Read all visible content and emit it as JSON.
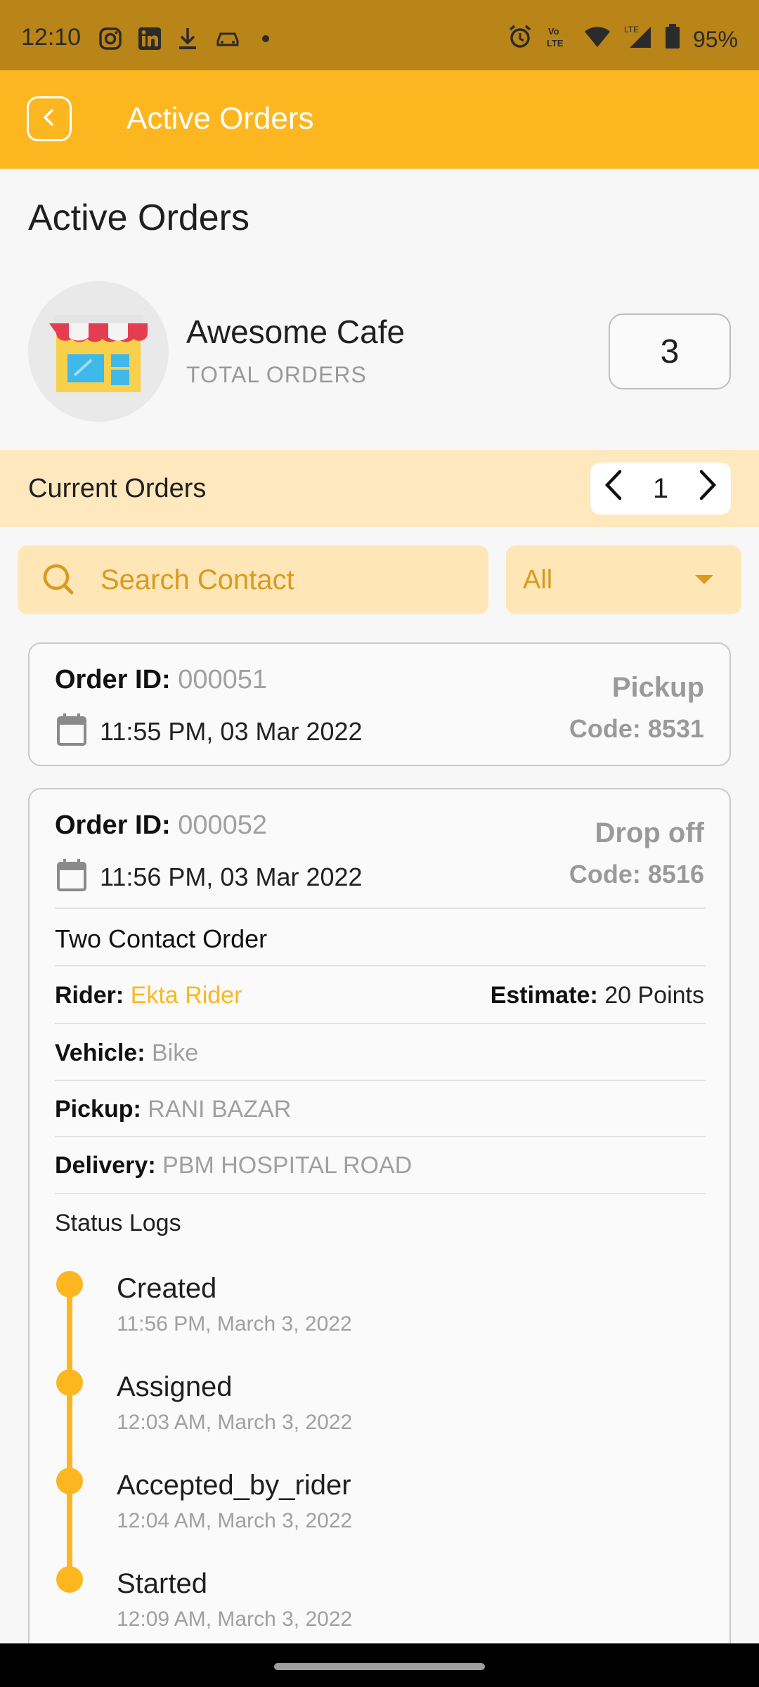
{
  "status_bar": {
    "time": "12:10",
    "battery": "95%",
    "icons": [
      "instagram-icon",
      "linkedin-icon",
      "download-icon",
      "car-icon",
      "dot-icon",
      "alarm-icon",
      "volte-icon",
      "wifi-icon",
      "signal-icon",
      "battery-icon"
    ]
  },
  "app_bar": {
    "title": "Active Orders"
  },
  "page": {
    "title": "Active Orders"
  },
  "store": {
    "name": "Awesome Cafe",
    "subtitle": "TOTAL ORDERS",
    "total_orders": "3"
  },
  "current": {
    "label": "Current Orders",
    "page": "1"
  },
  "search": {
    "placeholder": "Search Contact"
  },
  "filter": {
    "value": "All"
  },
  "orders": [
    {
      "id_label": "Order ID:",
      "id": "000051",
      "date": "11:55 PM, 03 Mar 2022",
      "type": "Pickup",
      "code": "Code: 8531"
    },
    {
      "id_label": "Order ID:",
      "id": "000052",
      "date": "11:56 PM, 03 Mar 2022",
      "type": "Drop off",
      "code": "Code: 8516",
      "title": "Two Contact Order",
      "rider_label": "Rider:",
      "rider": "Ekta Rider",
      "estimate_label": "Estimate:",
      "estimate": "20 Points",
      "vehicle_label": "Vehicle:",
      "vehicle": "Bike",
      "pickup_label": "Pickup:",
      "pickup": "RANI BAZAR",
      "delivery_label": "Delivery:",
      "delivery": "PBM HOSPITAL ROAD",
      "status_logs_title": "Status Logs",
      "logs": [
        {
          "status": "Created",
          "time": "11:56 PM, March 3, 2022"
        },
        {
          "status": "Assigned",
          "time": "12:03 AM, March 3, 2022"
        },
        {
          "status": "Accepted_by_rider",
          "time": "12:04 AM, March 3, 2022"
        },
        {
          "status": "Started",
          "time": "12:09 AM, March 3, 2022"
        }
      ]
    }
  ],
  "colors": {
    "accent": "#fcb720",
    "status_bar": "#b98418",
    "strip": "#ffe8bd",
    "search_bg": "#ffe6b6",
    "search_text": "#d99a1f"
  }
}
